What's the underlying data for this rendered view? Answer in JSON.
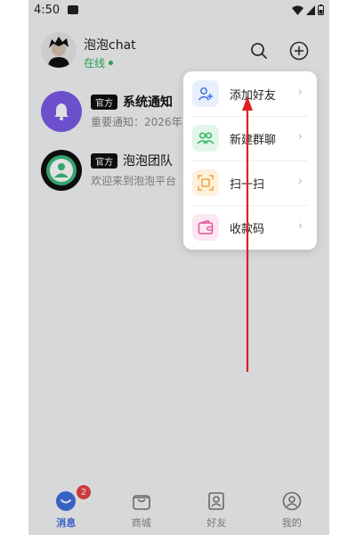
{
  "status_bar": {
    "time": "4:50"
  },
  "header": {
    "username": "泡泡chat",
    "status": "在线"
  },
  "conversations": [
    {
      "badge": "官方",
      "name": "系统通知",
      "preview": "重要通知：2026年"
    },
    {
      "badge": "官方",
      "name": "泡泡团队",
      "preview": "欢迎来到泡泡平台"
    }
  ],
  "menu": {
    "items": [
      {
        "label": "添加好友",
        "icon": "add-user-icon",
        "color": "#3f6fe0",
        "bg": "#e8eefc"
      },
      {
        "label": "新建群聊",
        "icon": "group-icon",
        "color": "#2db55d",
        "bg": "#e2f6ea"
      },
      {
        "label": "扫一扫",
        "icon": "scan-icon",
        "color": "#f0a430",
        "bg": "#fdf1de"
      },
      {
        "label": "收款码",
        "icon": "wallet-icon",
        "color": "#e0559a",
        "bg": "#fce6f0"
      }
    ]
  },
  "bottom_nav": {
    "tabs": [
      {
        "label": "消息",
        "icon": "chat-icon",
        "badge": "2"
      },
      {
        "label": "商城",
        "icon": "shop-icon"
      },
      {
        "label": "好友",
        "icon": "contacts-icon"
      },
      {
        "label": "我的",
        "icon": "profile-icon"
      }
    ]
  },
  "colors": {
    "accent": "#3f6fe0",
    "online": "#2db55d",
    "notification": "#e94343",
    "annotation": "#e02020"
  }
}
